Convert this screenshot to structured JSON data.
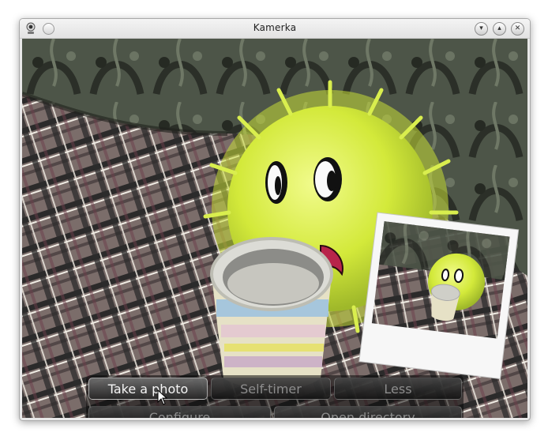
{
  "window": {
    "title": "Kamerka",
    "app_icon": "webcam-icon",
    "controls": {
      "minimize_icon": "chevron-down-icon",
      "maximize_icon": "chevron-up-icon",
      "close_icon": "close-icon"
    }
  },
  "camera": {
    "subject": "fluffy green ball with a mug on a plaid couch"
  },
  "toolbar": {
    "take_photo": "Take a photo",
    "self_timer": "Self-timer",
    "less": "Less",
    "configure": "Configure",
    "open_directory": "Open directory"
  },
  "colors": {
    "accent_green": "#d6ec3c",
    "panel": "#141414"
  }
}
